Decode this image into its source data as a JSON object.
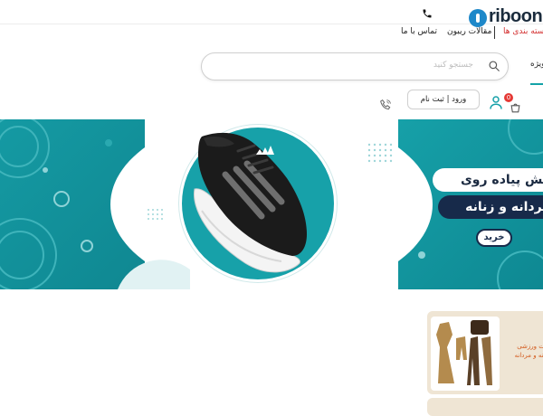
{
  "header": {
    "logo_text": "riboon",
    "nav": {
      "categories": "دسته بندی ها",
      "articles": "مقالات ریبون",
      "contact": "تماس با ما"
    },
    "categories_color": "#d32f2f"
  },
  "search": {
    "placeholder": "جستجو کنید",
    "special_tab": "ویژه"
  },
  "actions": {
    "login_register": "ورود | ثبت نام",
    "cart_count": "0"
  },
  "banner": {
    "line1": "کفش پیاده روی",
    "line2": "مردانه و زنانه",
    "cta": "خرید",
    "accent": "#14a0a8",
    "navy": "#172a4a"
  },
  "cards": {
    "card1_text": "ست ورزشی زنانه و مردانه"
  },
  "icons": [
    "phone-icon",
    "search-icon",
    "user-icon",
    "cart-icon",
    "support-icon"
  ]
}
